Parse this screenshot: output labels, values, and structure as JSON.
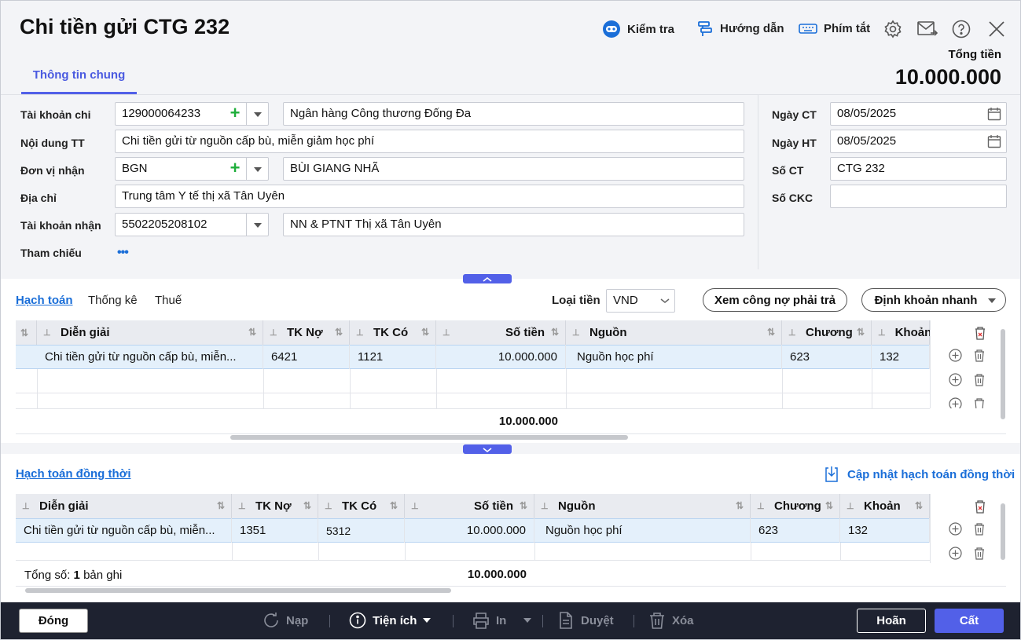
{
  "window": {
    "title": "Chi tiền gửi CTG 232"
  },
  "toolbar": {
    "check": "Kiểm tra",
    "guide": "Hướng dẫn",
    "shortcut": "Phím tắt"
  },
  "tabs": {
    "general": "Thông tin chung"
  },
  "total": {
    "label": "Tổng tiền",
    "value": "10.000.000"
  },
  "form": {
    "pay_account_label": "Tài khoản chi",
    "pay_account_value": "129000064233",
    "pay_bank": "Ngân hàng Công thương Đống Đa",
    "content_label": "Nội dung TT",
    "content_value": "Chi tiền gửi từ nguồn cấp bù, miễn giảm học phí",
    "receiver_label": "Đơn vị nhận",
    "receiver_code": "BGN",
    "receiver_name": "BÙI GIANG NHÃ",
    "address_label": "Địa chỉ",
    "address_value": "Trung tâm Y tế thị xã Tân Uyên",
    "recv_account_label": "Tài khoản nhận",
    "recv_account_value": "5502205208102",
    "recv_bank": "NN & PTNT Thị xã Tân Uyên",
    "ref_label": "Tham chiếu",
    "ref_more": "•••",
    "date_ct_label": "Ngày CT",
    "date_ct_value": "08/05/2025",
    "date_ht_label": "Ngày HT",
    "date_ht_value": "08/05/2025",
    "so_ct_label": "Số CT",
    "so_ct_value": "CTG 232",
    "so_ckc_label": "Số CKC",
    "so_ckc_value": ""
  },
  "accounting": {
    "tabs": [
      "Hạch toán",
      "Thống kê",
      "Thuế"
    ],
    "currency_label": "Loại tiền",
    "currency_value": "VND",
    "debt_button": "Xem công nợ phải trả",
    "quick_button": "Định khoản nhanh",
    "columns": [
      "Diễn giải",
      "TK Nợ",
      "TK Có",
      "Số tiền",
      "Nguồn",
      "Chương",
      "Khoản"
    ],
    "rows": [
      {
        "desc": "Chi tiền gửi từ nguồn cấp bù, miễn...",
        "debit": "6421",
        "credit": "1121",
        "amount": "10.000.000",
        "source": "Nguồn học phí",
        "chapter": "623",
        "item": "132"
      }
    ],
    "total": "10.000.000"
  },
  "concurrent": {
    "title": "Hạch toán đồng thời",
    "update_link": "Cập nhật hạch toán đồng thời",
    "columns": [
      "Diễn giải",
      "TK Nợ",
      "TK Có",
      "Số tiền",
      "Nguồn",
      "Chương",
      "Khoản"
    ],
    "rows": [
      {
        "desc": "Chi tiền gửi từ nguồn cấp bù, miễn...",
        "debit": "1351",
        "credit": "5312",
        "amount": "10.000.000",
        "source": "Nguồn học phí",
        "chapter": "623",
        "item": "132"
      }
    ],
    "count_prefix": "Tổng số:",
    "count_value": "1",
    "count_suffix": "bản ghi",
    "total": "10.000.000"
  },
  "footer": {
    "close": "Đóng",
    "reload": "Nạp",
    "utility": "Tiện ích",
    "print": "In",
    "approve": "Duyệt",
    "delete": "Xóa",
    "cancel": "Hoãn",
    "save": "Cất"
  },
  "colors": {
    "accent": "#5260e8",
    "link": "#1a6ed8",
    "footer_bg": "#1e2230",
    "add_green": "#1fae3b"
  }
}
